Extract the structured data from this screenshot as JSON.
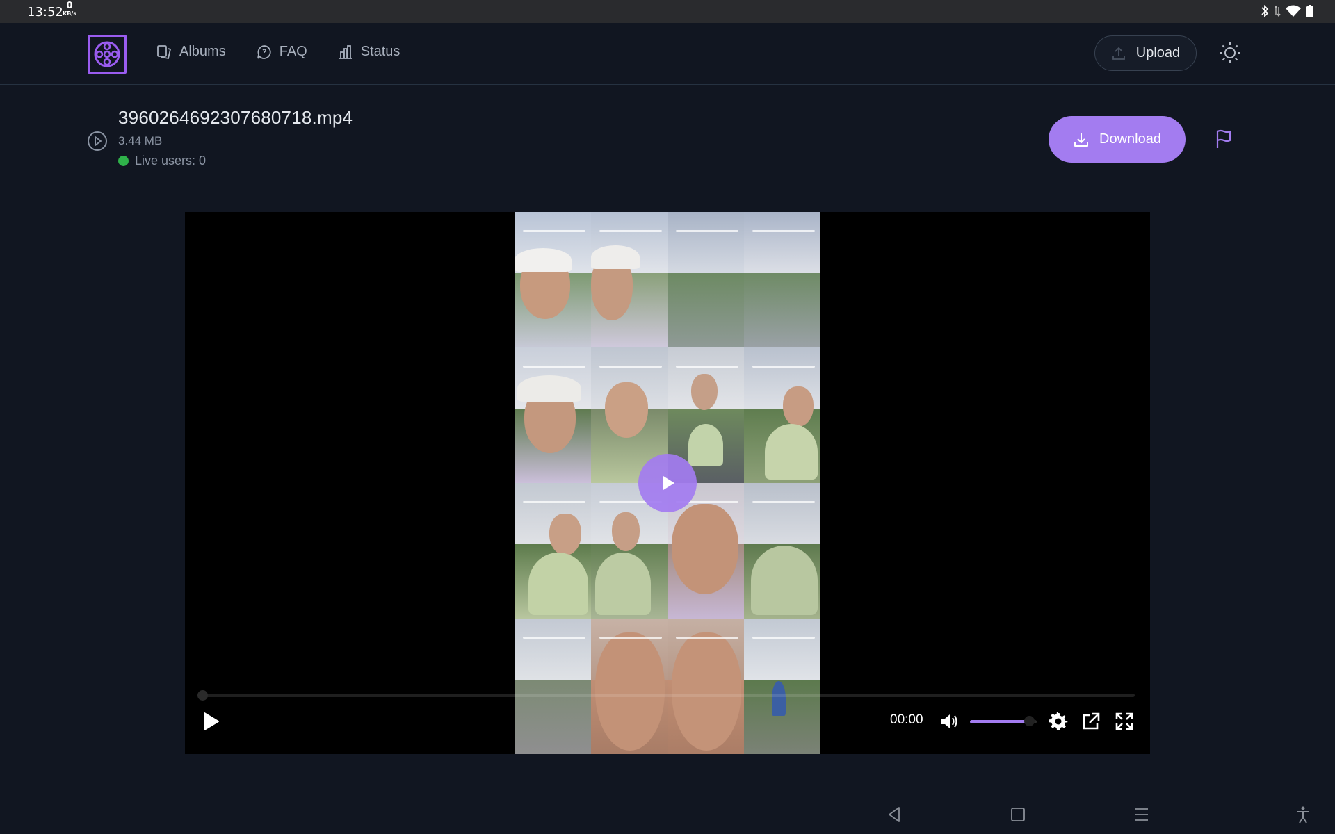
{
  "status_bar": {
    "time": "13:52",
    "net_speed_value": "0",
    "net_speed_unit": "KB/s",
    "icons": [
      "bluetooth-icon",
      "data-arrows-icon",
      "wifi-icon",
      "battery-icon"
    ]
  },
  "nav": {
    "albums": "Albums",
    "faq": "FAQ",
    "status": "Status"
  },
  "header": {
    "upload_label": "Upload"
  },
  "file": {
    "name": "3960264692307680718.mp4",
    "size": "3.44 MB",
    "live_users": "Live users: 0",
    "download_label": "Download"
  },
  "player": {
    "current_time": "00:00",
    "progress_fraction": 0,
    "volume_fraction": 0.9
  },
  "colors": {
    "accent": "#a37cf0",
    "background": "#111621",
    "live_indicator": "#2fb24a"
  }
}
